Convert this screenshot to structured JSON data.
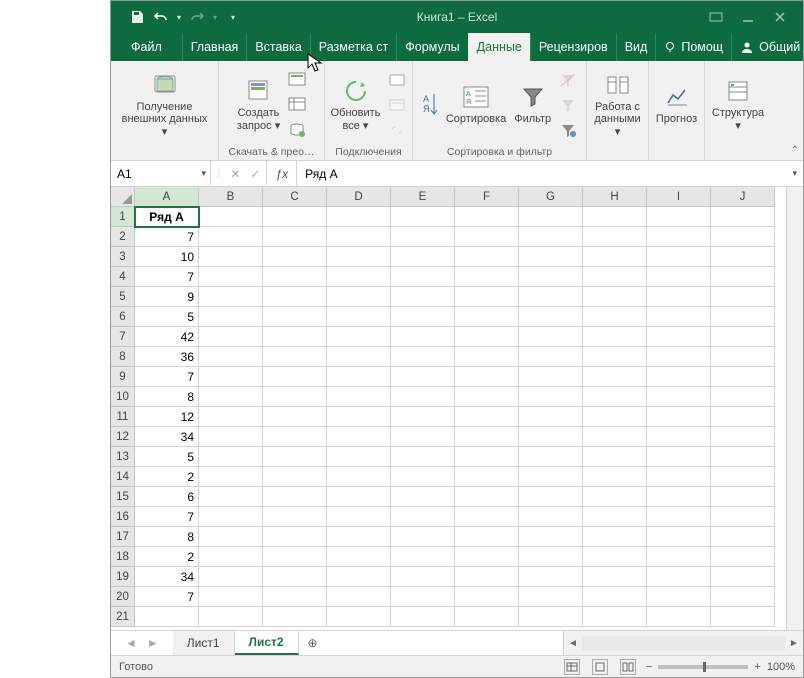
{
  "title": "Книга1 – Excel",
  "tabs": {
    "file": "Файл",
    "home": "Главная",
    "insert": "Вставка",
    "layout": "Разметка ст",
    "formulas": "Формулы",
    "data": "Данные",
    "review": "Рецензиров",
    "view": "Вид",
    "help": "Помощ",
    "share": "Общий доступ"
  },
  "ribbon": {
    "ext_data_btn": "Получение\nвнешних данных ▾",
    "create_query": "Создать\nзапрос ▾",
    "group1_label": "Скачать & прео…",
    "refresh_all": "Обновить\nвсе ▾",
    "group2_label": "Подключения",
    "sort": "Сортировка",
    "filter": "Фильтр",
    "group3_label": "Сортировка и фильтр",
    "work_data": "Работа с\nданными ▾",
    "forecast": "Прогноз",
    "structure": "Структура\n▾"
  },
  "namebox": "A1",
  "formula": "Ряд A",
  "chart_data": {
    "type": "table",
    "columns": [
      "A",
      "B",
      "C",
      "D",
      "E",
      "F",
      "G",
      "H",
      "I",
      "J"
    ],
    "rows": [
      {
        "n": 1,
        "A": "Ряд A"
      },
      {
        "n": 2,
        "A": 7
      },
      {
        "n": 3,
        "A": 10
      },
      {
        "n": 4,
        "A": 7
      },
      {
        "n": 5,
        "A": 9
      },
      {
        "n": 6,
        "A": 5
      },
      {
        "n": 7,
        "A": 42
      },
      {
        "n": 8,
        "A": 36
      },
      {
        "n": 9,
        "A": 7
      },
      {
        "n": 10,
        "A": 8
      },
      {
        "n": 11,
        "A": 12
      },
      {
        "n": 12,
        "A": 34
      },
      {
        "n": 13,
        "A": 5
      },
      {
        "n": 14,
        "A": 2
      },
      {
        "n": 15,
        "A": 6
      },
      {
        "n": 16,
        "A": 7
      },
      {
        "n": 17,
        "A": 8
      },
      {
        "n": 18,
        "A": 2
      },
      {
        "n": 19,
        "A": 34
      },
      {
        "n": 20,
        "A": 7
      },
      {
        "n": 21,
        "A": ""
      }
    ]
  },
  "sheets": {
    "s1": "Лист1",
    "s2": "Лист2"
  },
  "status": "Готово",
  "zoom": "100%"
}
